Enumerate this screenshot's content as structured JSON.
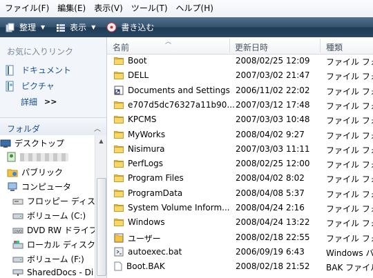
{
  "menu": [
    "ファイル(F)",
    "編集(E)",
    "表示(V)",
    "ツール(T)",
    "ヘルプ(H)"
  ],
  "toolbar": {
    "organize_label": "整理",
    "views_label": "表示",
    "burn_label": "書き込む"
  },
  "favorites": {
    "title": "お気に入りリンク",
    "items": [
      "ドキュメント",
      "ピクチャ"
    ],
    "details_label": "詳細"
  },
  "folders_pane": {
    "title": "フォルダ"
  },
  "tree": [
    {
      "label": "デスクトップ",
      "icon": "desktop-icon"
    },
    {
      "label": "",
      "icon": "user-folder-icon"
    },
    {
      "label": "パブリック",
      "icon": "public-folder-icon"
    },
    {
      "label": "コンピュータ",
      "icon": "computer-icon"
    },
    {
      "label": "フロッピー ディスク",
      "icon": "floppy-icon"
    },
    {
      "label": "ボリューム (C:)",
      "icon": "drive-icon"
    },
    {
      "label": "DVD RW ドライブ",
      "icon": "dvd-icon"
    },
    {
      "label": "ローカル ディスク",
      "icon": "local-disk-icon"
    },
    {
      "label": "ボリューム (F:)",
      "icon": "drive-icon"
    },
    {
      "label": "SharedDocs - Di",
      "icon": "network-drive-icon"
    }
  ],
  "columns": {
    "name": "名前",
    "modified": "更新日時",
    "type": "種類"
  },
  "files": [
    {
      "name": "Boot",
      "date": "2008/02/25 12:09",
      "type": "ファイル フォ",
      "icon": "folder-icon"
    },
    {
      "name": "DELL",
      "date": "2007/03/02 21:47",
      "type": "ファイル フォ",
      "icon": "folder-icon"
    },
    {
      "name": "Documents and Settings",
      "date": "2006/11/02 22:02",
      "type": "ファイル フォ",
      "icon": "shortcut-icon"
    },
    {
      "name": "e707d5dc76327a11b90...",
      "date": "2007/03/12 17:48",
      "type": "ファイル フォ",
      "icon": "folder-icon"
    },
    {
      "name": "KPCMS",
      "date": "2007/03/03 10:48",
      "type": "ファイル フォ",
      "icon": "folder-icon"
    },
    {
      "name": "MyWorks",
      "date": "2008/04/02 9:27",
      "type": "ファイル フォ",
      "icon": "folder-icon"
    },
    {
      "name": "Nisimura",
      "date": "2007/03/03 11:11",
      "type": "ファイル フォ",
      "icon": "folder-icon"
    },
    {
      "name": "PerfLogs",
      "date": "2008/02/25 12:00",
      "type": "ファイル フォ",
      "icon": "folder-icon"
    },
    {
      "name": "Program Files",
      "date": "2008/04/02 8:02",
      "type": "ファイル フォ",
      "icon": "folder-icon"
    },
    {
      "name": "ProgramData",
      "date": "2008/04/08 5:37",
      "type": "ファイル フォ",
      "icon": "folder-icon"
    },
    {
      "name": "System Volume Inform...",
      "date": "2008/04/24 2:16",
      "type": "ファイル フォ",
      "icon": "folder-icon"
    },
    {
      "name": "Windows",
      "date": "2008/04/24 13:22",
      "type": "ファイル フォ",
      "icon": "folder-icon"
    },
    {
      "name": "ユーザー",
      "date": "2008/02/18 22:55",
      "type": "ファイル フォ",
      "icon": "users-folder-icon"
    },
    {
      "name": "autoexec.bat",
      "date": "2006/09/19 6:43",
      "type": "Windows バ",
      "icon": "batch-file-icon"
    },
    {
      "name": "Boot.BAK",
      "date": "2008/02/18 21:52",
      "type": "BAK ファイル",
      "icon": "file-icon"
    }
  ],
  "colors": {
    "command_bar": "#2a4763",
    "link_text": "#1a4e92",
    "folder_yellow": "#f3c443"
  }
}
